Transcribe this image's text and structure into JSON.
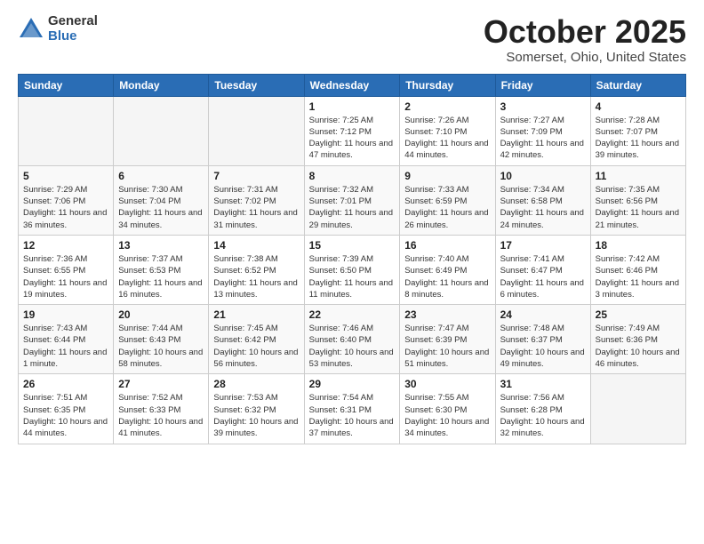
{
  "header": {
    "logo_general": "General",
    "logo_blue": "Blue",
    "month": "October 2025",
    "location": "Somerset, Ohio, United States"
  },
  "days_of_week": [
    "Sunday",
    "Monday",
    "Tuesday",
    "Wednesday",
    "Thursday",
    "Friday",
    "Saturday"
  ],
  "weeks": [
    [
      {
        "day": "",
        "info": ""
      },
      {
        "day": "",
        "info": ""
      },
      {
        "day": "",
        "info": ""
      },
      {
        "day": "1",
        "info": "Sunrise: 7:25 AM\nSunset: 7:12 PM\nDaylight: 11 hours\nand 47 minutes."
      },
      {
        "day": "2",
        "info": "Sunrise: 7:26 AM\nSunset: 7:10 PM\nDaylight: 11 hours\nand 44 minutes."
      },
      {
        "day": "3",
        "info": "Sunrise: 7:27 AM\nSunset: 7:09 PM\nDaylight: 11 hours\nand 42 minutes."
      },
      {
        "day": "4",
        "info": "Sunrise: 7:28 AM\nSunset: 7:07 PM\nDaylight: 11 hours\nand 39 minutes."
      }
    ],
    [
      {
        "day": "5",
        "info": "Sunrise: 7:29 AM\nSunset: 7:06 PM\nDaylight: 11 hours\nand 36 minutes."
      },
      {
        "day": "6",
        "info": "Sunrise: 7:30 AM\nSunset: 7:04 PM\nDaylight: 11 hours\nand 34 minutes."
      },
      {
        "day": "7",
        "info": "Sunrise: 7:31 AM\nSunset: 7:02 PM\nDaylight: 11 hours\nand 31 minutes."
      },
      {
        "day": "8",
        "info": "Sunrise: 7:32 AM\nSunset: 7:01 PM\nDaylight: 11 hours\nand 29 minutes."
      },
      {
        "day": "9",
        "info": "Sunrise: 7:33 AM\nSunset: 6:59 PM\nDaylight: 11 hours\nand 26 minutes."
      },
      {
        "day": "10",
        "info": "Sunrise: 7:34 AM\nSunset: 6:58 PM\nDaylight: 11 hours\nand 24 minutes."
      },
      {
        "day": "11",
        "info": "Sunrise: 7:35 AM\nSunset: 6:56 PM\nDaylight: 11 hours\nand 21 minutes."
      }
    ],
    [
      {
        "day": "12",
        "info": "Sunrise: 7:36 AM\nSunset: 6:55 PM\nDaylight: 11 hours\nand 19 minutes."
      },
      {
        "day": "13",
        "info": "Sunrise: 7:37 AM\nSunset: 6:53 PM\nDaylight: 11 hours\nand 16 minutes."
      },
      {
        "day": "14",
        "info": "Sunrise: 7:38 AM\nSunset: 6:52 PM\nDaylight: 11 hours\nand 13 minutes."
      },
      {
        "day": "15",
        "info": "Sunrise: 7:39 AM\nSunset: 6:50 PM\nDaylight: 11 hours\nand 11 minutes."
      },
      {
        "day": "16",
        "info": "Sunrise: 7:40 AM\nSunset: 6:49 PM\nDaylight: 11 hours\nand 8 minutes."
      },
      {
        "day": "17",
        "info": "Sunrise: 7:41 AM\nSunset: 6:47 PM\nDaylight: 11 hours\nand 6 minutes."
      },
      {
        "day": "18",
        "info": "Sunrise: 7:42 AM\nSunset: 6:46 PM\nDaylight: 11 hours\nand 3 minutes."
      }
    ],
    [
      {
        "day": "19",
        "info": "Sunrise: 7:43 AM\nSunset: 6:44 PM\nDaylight: 11 hours\nand 1 minute."
      },
      {
        "day": "20",
        "info": "Sunrise: 7:44 AM\nSunset: 6:43 PM\nDaylight: 10 hours\nand 58 minutes."
      },
      {
        "day": "21",
        "info": "Sunrise: 7:45 AM\nSunset: 6:42 PM\nDaylight: 10 hours\nand 56 minutes."
      },
      {
        "day": "22",
        "info": "Sunrise: 7:46 AM\nSunset: 6:40 PM\nDaylight: 10 hours\nand 53 minutes."
      },
      {
        "day": "23",
        "info": "Sunrise: 7:47 AM\nSunset: 6:39 PM\nDaylight: 10 hours\nand 51 minutes."
      },
      {
        "day": "24",
        "info": "Sunrise: 7:48 AM\nSunset: 6:37 PM\nDaylight: 10 hours\nand 49 minutes."
      },
      {
        "day": "25",
        "info": "Sunrise: 7:49 AM\nSunset: 6:36 PM\nDaylight: 10 hours\nand 46 minutes."
      }
    ],
    [
      {
        "day": "26",
        "info": "Sunrise: 7:51 AM\nSunset: 6:35 PM\nDaylight: 10 hours\nand 44 minutes."
      },
      {
        "day": "27",
        "info": "Sunrise: 7:52 AM\nSunset: 6:33 PM\nDaylight: 10 hours\nand 41 minutes."
      },
      {
        "day": "28",
        "info": "Sunrise: 7:53 AM\nSunset: 6:32 PM\nDaylight: 10 hours\nand 39 minutes."
      },
      {
        "day": "29",
        "info": "Sunrise: 7:54 AM\nSunset: 6:31 PM\nDaylight: 10 hours\nand 37 minutes."
      },
      {
        "day": "30",
        "info": "Sunrise: 7:55 AM\nSunset: 6:30 PM\nDaylight: 10 hours\nand 34 minutes."
      },
      {
        "day": "31",
        "info": "Sunrise: 7:56 AM\nSunset: 6:28 PM\nDaylight: 10 hours\nand 32 minutes."
      },
      {
        "day": "",
        "info": ""
      }
    ]
  ]
}
